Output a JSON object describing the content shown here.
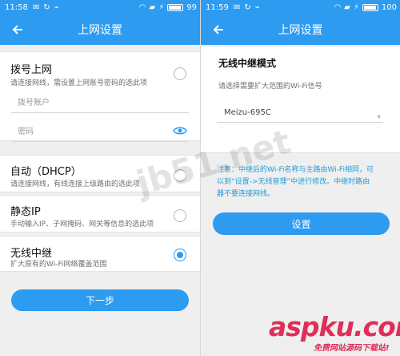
{
  "left": {
    "status": {
      "time": "11:58",
      "battery": "99"
    },
    "header": {
      "title": "上网设置"
    },
    "dialup": {
      "title": "拨号上网",
      "subtitle": "请连接网线，需设置上网账号密码的选此项",
      "account_placeholder": "拨号账户",
      "password_placeholder": "密码"
    },
    "dhcp": {
      "title": "自动（DHCP）",
      "subtitle": "请连接网线，有线连接上级路由的选此项"
    },
    "static": {
      "title": "静态IP",
      "subtitle": "手动输入IP、子网掩码、网关等信息的选此项"
    },
    "repeater": {
      "title": "无线中继",
      "subtitle": "扩大原有的Wi-Fi网络覆盖范围"
    },
    "next_button": "下一步"
  },
  "right": {
    "status": {
      "time": "11:59",
      "battery": "100"
    },
    "header": {
      "title": "上网设置"
    },
    "mode_title": "无线中继模式",
    "mode_subtitle": "请选择需要扩大范围的Wi-Fi信号",
    "selected_wifi": "Meizu-695C",
    "note": "注意：中继后的Wi-Fi名称与主路由Wi-Fi相同，可以到“设置->无线管理”中进行修改。中继时路由器不要连接网线。",
    "settings_button": "设置"
  },
  "watermarks": {
    "center": "jb51.net",
    "brand": "aspku.com",
    "brand_sub": "免费网站源码下载站!"
  },
  "colors": {
    "accent": "#2d9bf0",
    "note": "#1e9cd8"
  }
}
